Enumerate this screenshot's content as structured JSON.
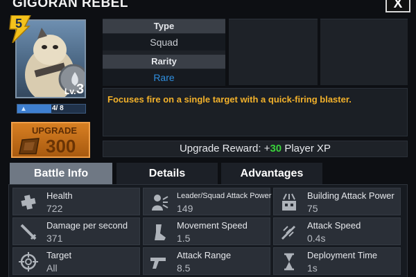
{
  "header": {
    "title": "GIGORAN REBEL",
    "close_label": "X"
  },
  "unit": {
    "tier": "5",
    "level_label": "Lv.",
    "level": "3",
    "card_progress_text": "4/ 8",
    "card_progress_fraction": 0.5
  },
  "upgrade": {
    "label": "UPGRADE",
    "cost": "300"
  },
  "info": {
    "type_label": "Type",
    "type_value": "Squad",
    "rarity_label": "Rarity",
    "rarity_value": "Rare",
    "rarity_color": "#2f8fe0",
    "description": "Focuses fire on a single target with a quick-firing blaster.",
    "description_color": "#f2b12b",
    "reward_prefix": "Upgrade Reward: +",
    "reward_amount": "30",
    "reward_suffix": " Player XP",
    "reward_color": "#39d13b"
  },
  "tabs": [
    {
      "label": "Battle Info",
      "active": true
    },
    {
      "label": "Details",
      "active": false
    },
    {
      "label": "Advantages",
      "active": false
    }
  ],
  "stats": [
    {
      "label": "Health",
      "value": "722",
      "icon": "health-icon"
    },
    {
      "label": "Leader/Squad Attack Power",
      "value": "149",
      "icon": "squad-attack-icon"
    },
    {
      "label": "Building Attack Power",
      "value": "75",
      "icon": "building-attack-icon"
    },
    {
      "label": "Damage per second",
      "value": "371",
      "icon": "damage-icon"
    },
    {
      "label": "Movement Speed",
      "value": "1.5",
      "icon": "movement-speed-icon"
    },
    {
      "label": "Attack Speed",
      "value": "0.4s",
      "icon": "attack-speed-icon"
    },
    {
      "label": "Target",
      "value": "All",
      "icon": "target-icon"
    },
    {
      "label": "Attack Range",
      "value": "8.5",
      "icon": "blaster-icon"
    },
    {
      "label": "Deployment Time",
      "value": "1s",
      "icon": "hourglass-icon"
    }
  ]
}
